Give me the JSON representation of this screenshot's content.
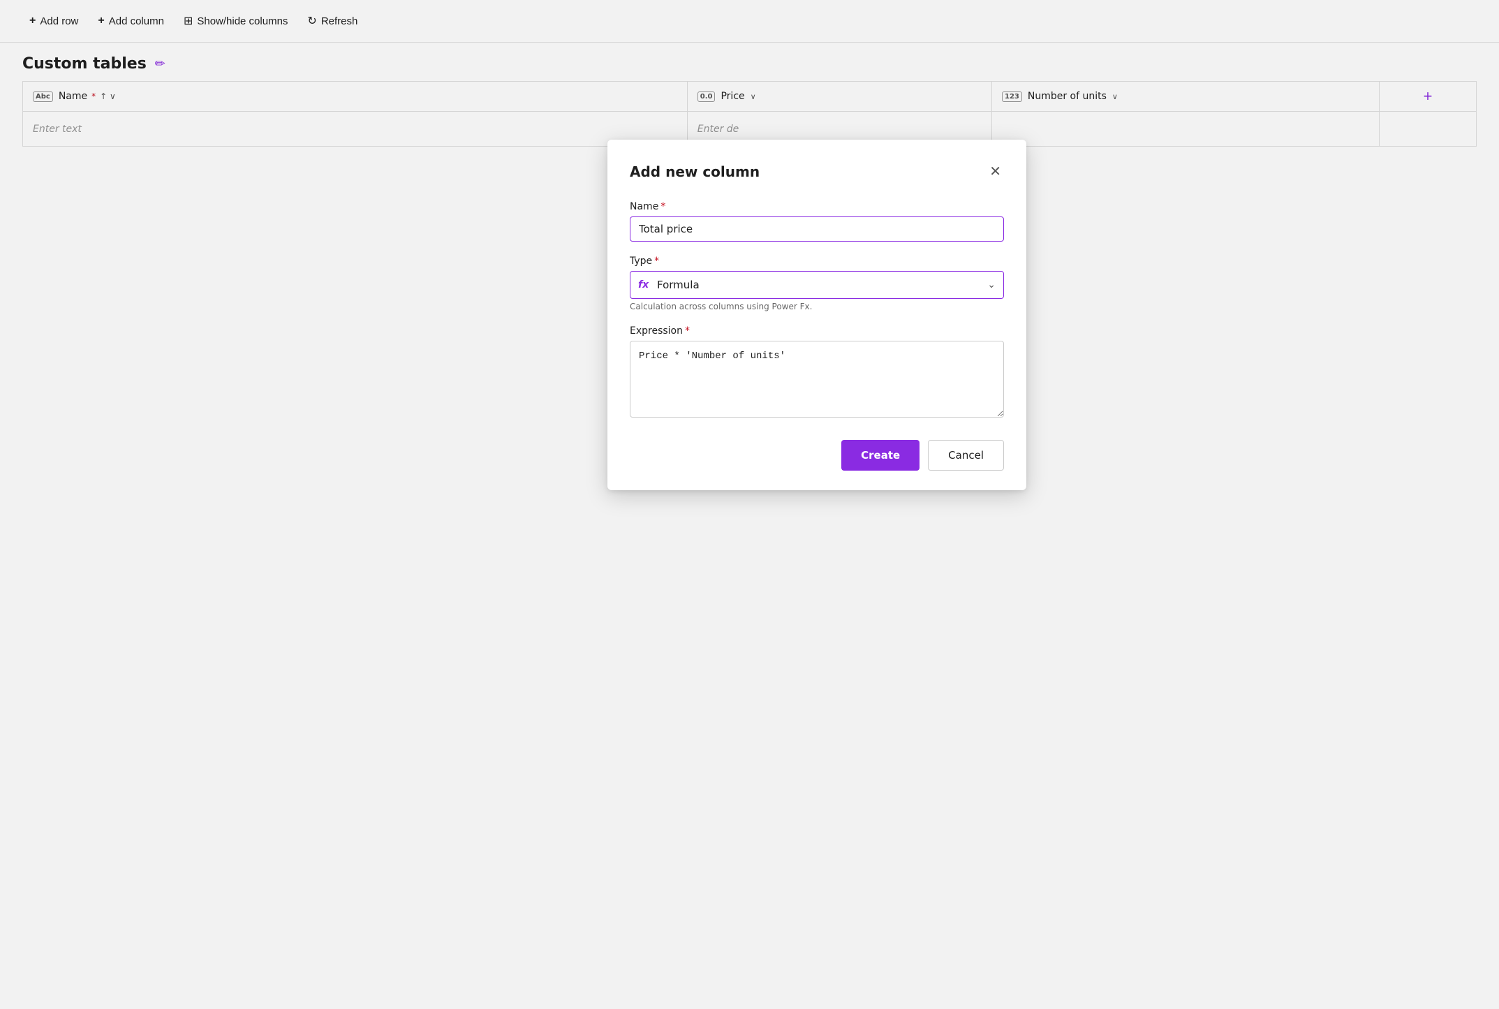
{
  "toolbar": {
    "add_row_label": "Add row",
    "add_column_label": "Add column",
    "show_hide_label": "Show/hide columns",
    "refresh_label": "Refresh"
  },
  "page": {
    "title": "Custom tables",
    "edit_tooltip": "Edit"
  },
  "table": {
    "columns": [
      {
        "id": "name",
        "type_badge": "Abc",
        "label": "Name",
        "required": true,
        "sortable": true
      },
      {
        "id": "price",
        "type_badge": "0.0",
        "label": "Price",
        "required": false,
        "sortable": false
      },
      {
        "id": "units",
        "type_badge": "123",
        "label": "Number of units",
        "required": false,
        "sortable": false
      }
    ],
    "row_placeholder_name": "Enter text",
    "row_placeholder_price": "Enter de",
    "add_column_symbol": "+"
  },
  "modal": {
    "title": "Add new column",
    "name_label": "Name",
    "name_required": "*",
    "name_value": "Total price",
    "type_label": "Type",
    "type_required": "*",
    "type_value": "Formula",
    "type_fx_icon": "fx",
    "type_hint": "Calculation across columns using Power Fx.",
    "expression_label": "Expression",
    "expression_required": "*",
    "expression_value": "Price * 'Number of units'",
    "create_label": "Create",
    "cancel_label": "Cancel",
    "close_icon": "✕"
  }
}
